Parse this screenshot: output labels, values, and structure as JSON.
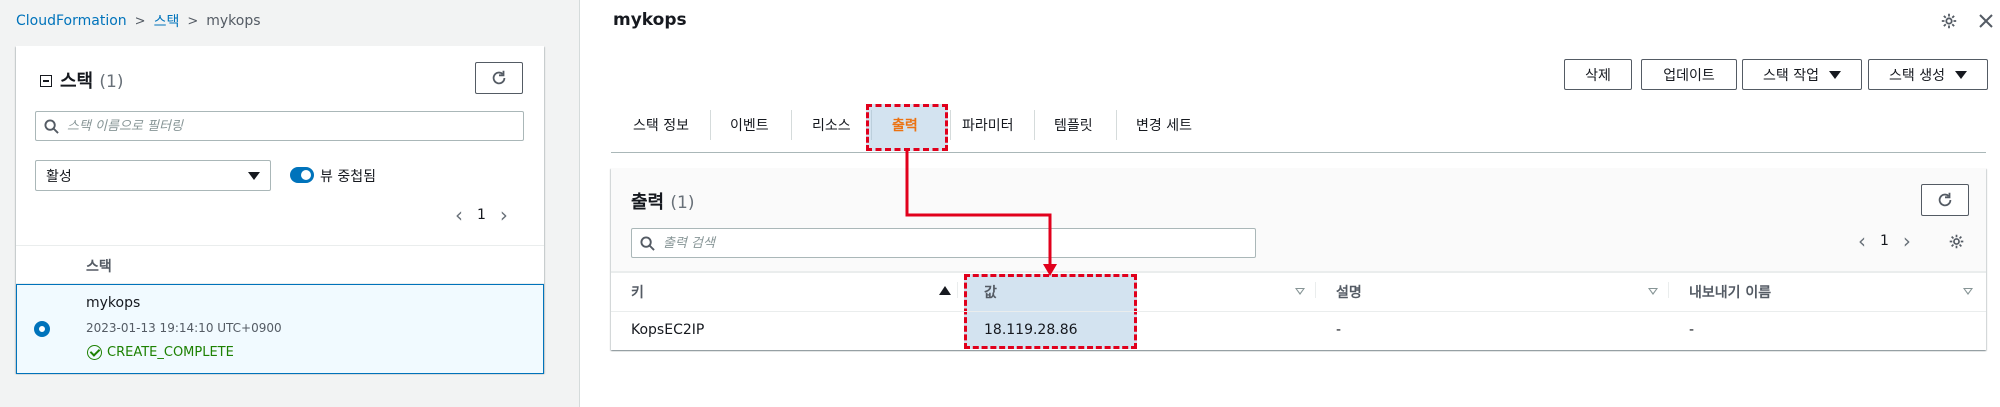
{
  "breadcrumb": {
    "root": "CloudFormation",
    "stacks": "스택",
    "current": "mykops"
  },
  "stacks_panel": {
    "title": "스택",
    "count": "(1)",
    "search_placeholder": "스택 이름으로 필터링",
    "filter_select": "활성",
    "nested_view_label": "뷰 중첩됨",
    "page_number": "1",
    "column_header": "스택",
    "stack": {
      "name": "mykops",
      "timestamp": "2023-01-13 19:14:10 UTC+0900",
      "status": "CREATE_COMPLETE"
    }
  },
  "detail": {
    "title": "mykops",
    "actions": {
      "delete": "삭제",
      "update": "업데이트",
      "stack_actions": "스택 작업",
      "create_stack": "스택 생성"
    },
    "tabs": [
      "스택 정보",
      "이벤트",
      "리소스",
      "출력",
      "파라미터",
      "템플릿",
      "변경 세트"
    ],
    "active_tab_index": 3,
    "outputs": {
      "title": "출력",
      "count": "(1)",
      "search_placeholder": "출력 검색",
      "page_number": "1",
      "columns": [
        "키",
        "값",
        "설명",
        "내보내기 이름"
      ],
      "rows": [
        {
          "key": "KopsEC2IP",
          "value": "18.119.28.86",
          "description": "-",
          "export_name": "-"
        }
      ]
    }
  },
  "colors": {
    "accent": "#0073bb",
    "active_tab": "#ec7211",
    "annotation": "#e1001c",
    "success": "#1d8102"
  }
}
